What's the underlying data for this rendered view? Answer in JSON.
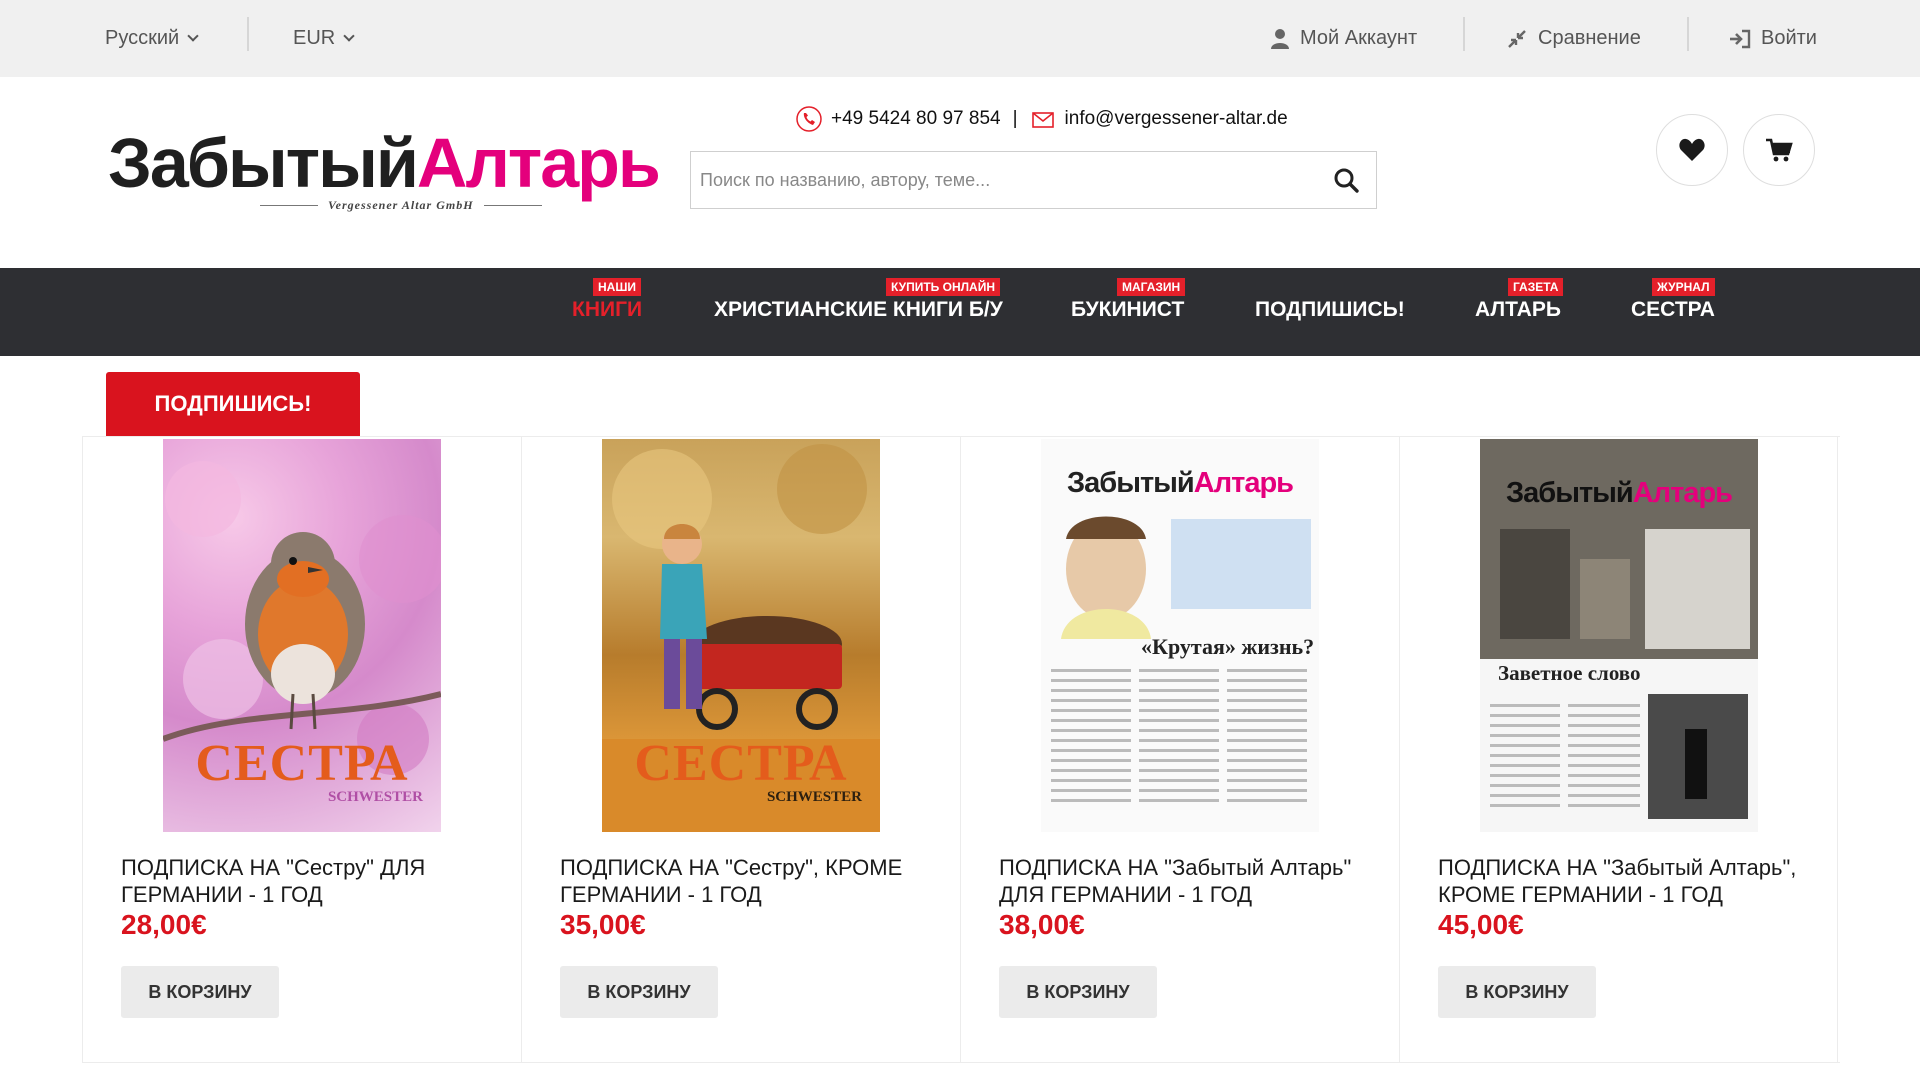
{
  "topbar": {
    "language": "Русский",
    "currency": "EUR",
    "account": "Мой Аккаунт",
    "compare": "Сравнение",
    "login": "Войти"
  },
  "header": {
    "logo_dark": "Забытый",
    "logo_pink": "Алтарь",
    "logo_sub": "Vergessener Altar GmbH",
    "phone": "+49 5424 80 97 854",
    "separator": "|",
    "email": "info@vergessener-altar.de",
    "search_placeholder": "Поиск по названию, автору, теме..."
  },
  "nav": [
    {
      "badge": "НАШИ",
      "label": "КНИГИ",
      "active": true
    },
    {
      "badge": "КУПИТЬ ОНЛАЙН",
      "label": "ХРИСТИАНСКИЕ КНИГИ Б/У",
      "active": false
    },
    {
      "badge": "МАГАЗИН",
      "label": "БУКИНИСТ",
      "active": false
    },
    {
      "badge": "",
      "label": "ПОДПИШИСЬ!",
      "active": false
    },
    {
      "badge": "ГАЗЕТА",
      "label": "АЛТАРЬ",
      "active": false
    },
    {
      "badge": "ЖУРНАЛ",
      "label": "СЕСТРА",
      "active": false
    }
  ],
  "section_tab": "ПОДПИШИСЬ!",
  "products": [
    {
      "title": "ПОДПИСКА НА \"Сестру\" ДЛЯ ГЕРМАНИИ - 1 ГОД",
      "price": "28,00€",
      "button": "В КОРЗИНУ",
      "cover_title": "СЕСТРА",
      "cover_sub": "SCHWESTER"
    },
    {
      "title": "ПОДПИСКА НА \"Сестру\", КРОМЕ ГЕРМАНИИ - 1 ГОД",
      "price": "35,00€",
      "button": "В КОРЗИНУ",
      "cover_title": "СЕСТРА",
      "cover_sub": "SCHWESTER"
    },
    {
      "title": "ПОДПИСКА НА \"Забытый Алтарь\" ДЛЯ ГЕРМАНИИ - 1 ГОД",
      "price": "38,00€",
      "button": "В КОРЗИНУ",
      "cover_title_dark": "Забытый",
      "cover_title_pink": "Алтарь",
      "cover_headline": "«Крутая» жизнь?"
    },
    {
      "title": "ПОДПИСКА НА \"Забытый Алтарь\", КРОМЕ ГЕРМАНИИ - 1 ГОД",
      "price": "45,00€",
      "button": "В КОРЗИНУ",
      "cover_title_dark": "Забытый",
      "cover_title_pink": "Алтарь",
      "cover_headline": "Заветное слово"
    }
  ],
  "colors": {
    "accent_red": "#d9131e",
    "logo_pink": "#e4007c",
    "nav_bg": "#2e2f33",
    "topbar_bg": "#f0f0f0"
  }
}
